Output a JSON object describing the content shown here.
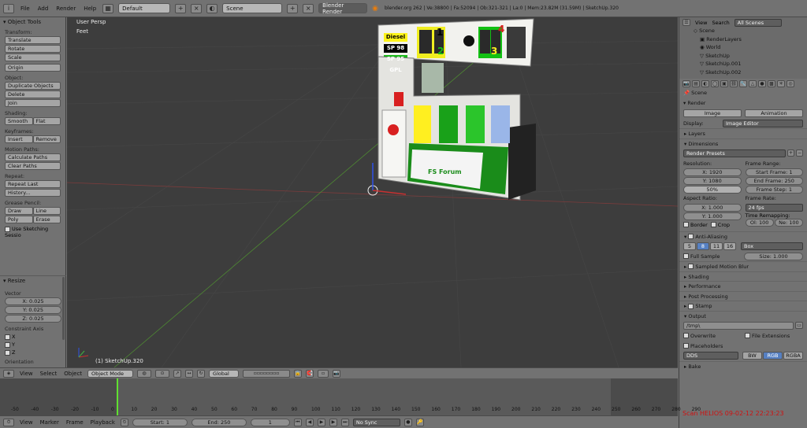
{
  "topbar": {
    "menus": [
      "File",
      "Add",
      "Render",
      "Help"
    ],
    "layout": "Default",
    "scene": "Scene",
    "engine": "Blender Render",
    "info": "blender.org 262 | Ve:38800 | Fa:52094 | Ob:321-321 | La:0 | Mem:23.82M (31.59M) | SketchUp.320"
  },
  "tools": {
    "header": "Object Tools",
    "transform_label": "Transform:",
    "translate": "Translate",
    "rotate": "Rotate",
    "scale": "Scale",
    "origin": "Origin",
    "object_label": "Object:",
    "duplicate": "Duplicate Objects",
    "delete": "Delete",
    "join": "Join",
    "shading_label": "Shading:",
    "smooth": "Smooth",
    "flat": "Flat",
    "keyframes_label": "Keyframes:",
    "insert": "Insert",
    "remove": "Remove",
    "motion_label": "Motion Paths:",
    "calc_paths": "Calculate Paths",
    "clear_paths": "Clear Paths",
    "repeat_label": "Repeat:",
    "repeat_last": "Repeat Last",
    "history": "History...",
    "grease_label": "Grease Pencil:",
    "draw": "Draw",
    "line": "Line",
    "poly": "Poly",
    "erase": "Erase",
    "sketching": "Use Sketching Sessio"
  },
  "resize": {
    "header": "Resize",
    "vector_label": "Vector",
    "x": "X: 0.025",
    "y": "Y: 0.025",
    "z": "Z: 0.025",
    "constraint_label": "Constraint Axis",
    "ax_x": "X",
    "ax_y": "Y",
    "ax_z": "Z",
    "orientation": "Orientation"
  },
  "viewport": {
    "view_name": "User Persp",
    "units": "Feet",
    "object_label": "(1) SketchUp.320",
    "sign": {
      "diesel": "Diesel",
      "sp98": "SP 98",
      "sp95": "SP 95",
      "gpl": "GPL",
      "n1": "1",
      "n2": "2",
      "n3": "3",
      "n4": "4",
      "logo": "FS Forum"
    }
  },
  "viewheader": {
    "menus": [
      "View",
      "Select",
      "Object"
    ],
    "mode": "Object Mode",
    "orientation": "Global"
  },
  "timeline": {
    "ticks": [
      "-50",
      "-40",
      "-30",
      "-20",
      "-10",
      "0",
      "10",
      "20",
      "30",
      "40",
      "50",
      "60",
      "70",
      "80",
      "90",
      "100",
      "110",
      "120",
      "130",
      "140",
      "150",
      "160",
      "170",
      "180",
      "190",
      "200",
      "210",
      "220",
      "230",
      "240",
      "250",
      "260",
      "270",
      "280",
      "290"
    ],
    "current_frame": 1
  },
  "tlheader": {
    "menus": [
      "View",
      "Marker",
      "Frame",
      "Playback"
    ],
    "start": "Start: 1",
    "end": "End: 250",
    "current": "1",
    "sync": "No Sync"
  },
  "outliner": {
    "view": "View",
    "search": "Search",
    "filter": "All Scenes",
    "items": [
      "Scene",
      "RenderLayers",
      "World",
      "SketchUp",
      "SketchUp.001",
      "SketchUp.002"
    ]
  },
  "props": {
    "scene_name": "Scene",
    "render_head": "Render",
    "image": "Image",
    "animation": "Animation",
    "display_label": "Display:",
    "display_value": "Image Editor",
    "layers": "Layers",
    "dimensions": "Dimensions",
    "render_presets": "Render Presets",
    "resolution_label": "Resolution:",
    "res_x": "X: 1920",
    "res_y": "Y: 1080",
    "res_pct": "50%",
    "frame_range_label": "Frame Range:",
    "start_frame": "Start Frame: 1",
    "end_frame": "End Frame: 250",
    "frame_step": "Frame Step: 1",
    "aspect_label": "Aspect Ratio:",
    "asp_x": "X: 1.000",
    "asp_y": "Y: 1.000",
    "frame_rate_label": "Frame Rate:",
    "fps": "24 fps",
    "time_remap_label": "Time Remapping:",
    "old": "Ol: 100",
    "new": "Ne: 100",
    "border": "Border",
    "crop": "Crop",
    "aa": "Anti-Aliasing",
    "aa_levels": [
      "5",
      "8",
      "11",
      "16"
    ],
    "aa_filter": "Box",
    "full_sample": "Full Sample",
    "aa_size": "Size: 1.000",
    "motion_blur": "Sampled Motion Blur",
    "shading": "Shading",
    "performance": "Performance",
    "post": "Post Processing",
    "stamp": "Stamp",
    "output": "Output",
    "output_path": "/tmp\\",
    "overwrite": "Overwrite",
    "file_ext": "File Extensions",
    "placeholders": "Placeholders",
    "format": "DDS",
    "bw": "BW",
    "rgb": "RGB",
    "rgba": "RGBA",
    "bake": "Bake",
    "watermark": "Scan HELIOS 09-02-12 22:23:23"
  },
  "colors": {
    "active_blue": "#5680c2",
    "watermark_red": "#d01010",
    "frame_line": "#60e030"
  }
}
